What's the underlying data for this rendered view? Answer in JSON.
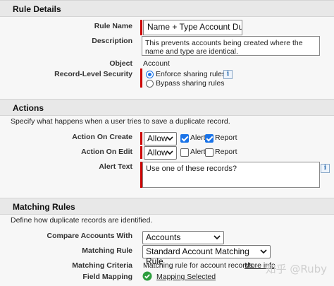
{
  "rule_details": {
    "header": "Rule Details",
    "rule_name_label": "Rule Name",
    "rule_name_value": "Name + Type Account Dupl",
    "description_label": "Description",
    "description_value": "This prevents accounts being created where the name and type are identical.",
    "object_label": "Object",
    "object_value": "Account",
    "record_security_label": "Record-Level Security",
    "security_options": [
      "Enforce sharing rules",
      "Bypass sharing rules"
    ],
    "security_selected": "Enforce sharing rules",
    "info_glyph": "i"
  },
  "actions": {
    "header": "Actions",
    "intro": "Specify what happens when a user tries to save a duplicate record.",
    "on_create_label": "Action On Create",
    "on_create_value": "Allow",
    "on_create_alert_label": "Alert",
    "on_create_alert_checked": true,
    "on_create_report_label": "Report",
    "on_create_report_checked": true,
    "on_edit_label": "Action On Edit",
    "on_edit_value": "Allow",
    "on_edit_alert_label": "Alert",
    "on_edit_alert_checked": false,
    "on_edit_report_label": "Report",
    "on_edit_report_checked": false,
    "alert_text_label": "Alert Text",
    "alert_text_value": "Use one of these records?"
  },
  "matching_rules": {
    "header": "Matching Rules",
    "intro": "Define how duplicate records are identified.",
    "compare_label": "Compare Accounts With",
    "compare_value": "Accounts",
    "matching_rule_label": "Matching Rule",
    "matching_rule_value": "Standard Account Matching Rule",
    "criteria_label": "Matching Criteria",
    "criteria_value": "Matching rule for account records.",
    "criteria_link": "More info",
    "field_mapping_label": "Field Mapping",
    "field_mapping_value": "Mapping Selected"
  },
  "watermark": "知乎 @Ruby",
  "colors": {
    "required_bar": "#cc0000",
    "accent": "#1a73e8",
    "success": "#2e9e3e",
    "header_bg": "#e8e8e8"
  }
}
